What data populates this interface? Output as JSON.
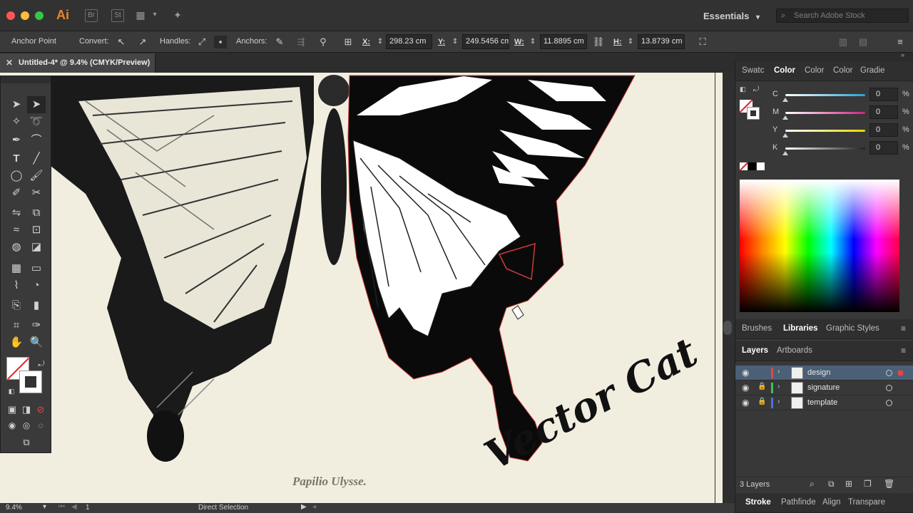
{
  "app": {
    "name": "Ai",
    "bridge": "Br",
    "stock": "St",
    "workspace": "Essentials",
    "search_placeholder": "Search Adobe Stock"
  },
  "control_bar": {
    "tool_name": "Anchor Point",
    "convert_label": "Convert:",
    "handles_label": "Handles:",
    "anchors_label": "Anchors:",
    "x_label": "X:",
    "x_value": "298.23 cm",
    "y_label": "Y:",
    "y_value": "249.5456 cm",
    "w_label": "W:",
    "w_value": "11.8895 cm",
    "h_label": "H:",
    "h_value": "13.8739 cm"
  },
  "document_tab": {
    "title": "Untitled-4* @ 9.4% (CMYK/Preview)"
  },
  "canvas": {
    "caption": "Papilio Ulysse.",
    "signature_text": "Vector Cat"
  },
  "status_bar": {
    "zoom": "9.4%",
    "artboard": "1",
    "tool": "Direct Selection"
  },
  "color_panel": {
    "tabs": [
      "Swatc",
      "Color",
      "Color",
      "Color",
      "Gradie"
    ],
    "active_tab_index": 1,
    "channels": [
      {
        "label": "C",
        "value": "0",
        "unit": "%",
        "color": "#22a5d8"
      },
      {
        "label": "M",
        "value": "0",
        "unit": "%",
        "color": "#d0207f"
      },
      {
        "label": "Y",
        "value": "0",
        "unit": "%",
        "color": "#e8d800"
      },
      {
        "label": "K",
        "value": "0",
        "unit": "%",
        "color": "#555555"
      }
    ]
  },
  "mid_panel": {
    "tabs": [
      "Brushes",
      "Libraries",
      "Graphic Styles"
    ],
    "active_tab_index": 1
  },
  "layers_panel": {
    "tabs": [
      "Layers",
      "Artboards"
    ],
    "active_tab_index": 0,
    "layers": [
      {
        "name": "design",
        "color": "#e04848",
        "locked": false,
        "selected": true
      },
      {
        "name": "signature",
        "color": "#3cc25a",
        "locked": true,
        "selected": false
      },
      {
        "name": "template",
        "color": "#4a6fe0",
        "locked": true,
        "selected": false
      }
    ],
    "count": "3 Layers"
  },
  "bottom_panel": {
    "tabs": [
      "Stroke",
      "Pathfinde",
      "Align",
      "Transpare"
    ],
    "active_tab_index": 0
  }
}
